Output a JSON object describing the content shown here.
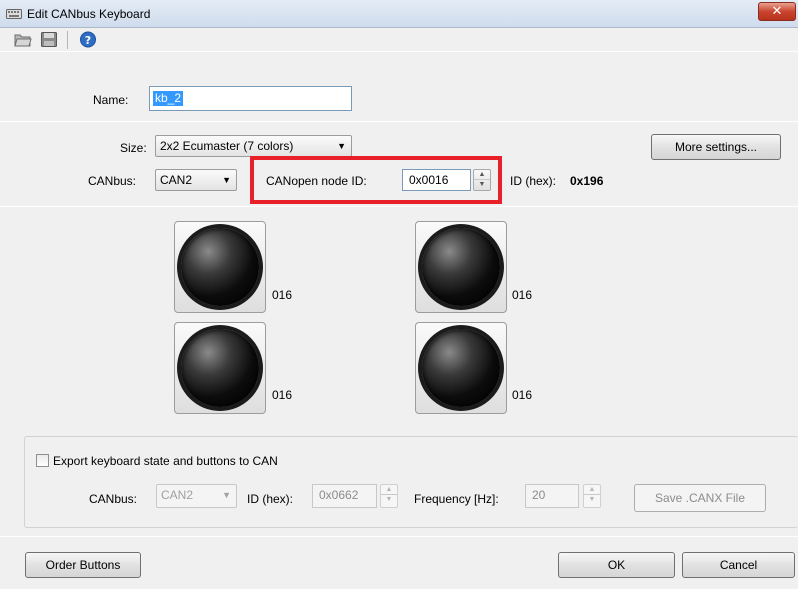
{
  "window": {
    "title": "Edit CANbus Keyboard",
    "close_glyph": "✕"
  },
  "toolbar": {
    "icons": [
      "open-folder-icon",
      "save-icon",
      "help-icon"
    ]
  },
  "name": {
    "label": "Name:",
    "value": "kb_2"
  },
  "size": {
    "label": "Size:",
    "value": "2x2 Ecumaster (7 colors)",
    "more_settings": "More settings..."
  },
  "canbus": {
    "label": "CANbus:",
    "value": "CAN2"
  },
  "canopen": {
    "label": "CANopen node ID:",
    "value": "0x0016",
    "id_hex_label": "ID (hex):",
    "id_hex_value": "0x196"
  },
  "keys": [
    {
      "label": "016"
    },
    {
      "label": "016"
    },
    {
      "label": "016"
    },
    {
      "label": "016"
    }
  ],
  "export": {
    "checkbox_label": "Export keyboard state and buttons to CAN",
    "checked": false,
    "canbus_label": "CANbus:",
    "canbus_value": "CAN2",
    "id_label": "ID (hex):",
    "id_value": "0x0662",
    "freq_label": "Frequency [Hz]:",
    "freq_value": "20",
    "save_label": "Save .CANX File"
  },
  "footer": {
    "order_buttons": "Order Buttons",
    "ok": "OK",
    "cancel": "Cancel"
  },
  "colors": {
    "highlight": "#e8202a",
    "selection": "#3399ff",
    "close": "#c9452f"
  }
}
